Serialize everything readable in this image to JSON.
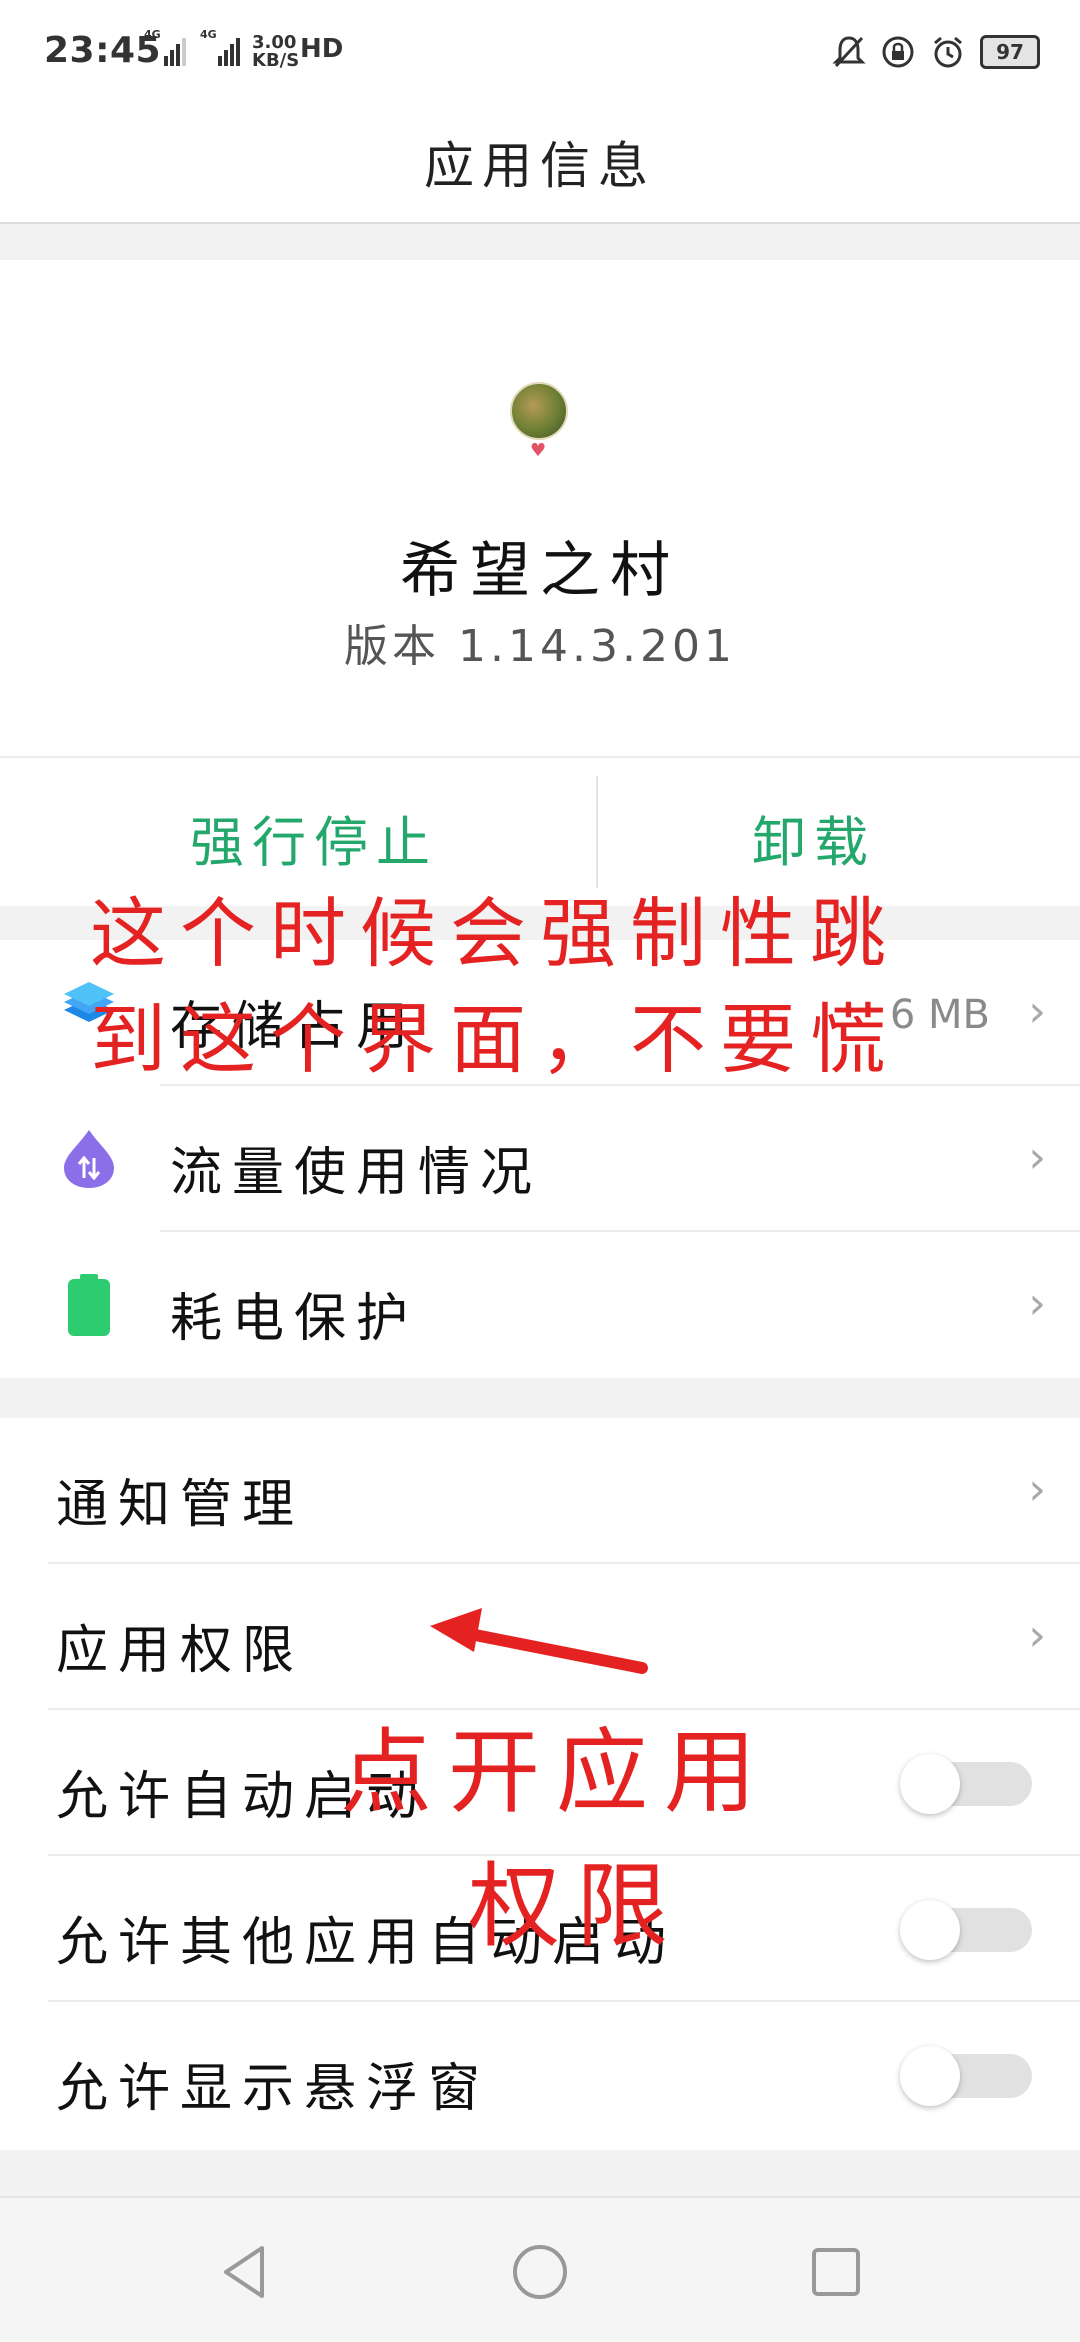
{
  "status_bar": {
    "time": "23:45",
    "network_speed_value": "3.00",
    "network_speed_unit": "KB/S",
    "hd_label": "HD",
    "battery": "97"
  },
  "header": {
    "title": "应用信息"
  },
  "app": {
    "name": "希望之村",
    "version": "版本 1.14.3.201"
  },
  "actions": {
    "force_stop": "强行停止",
    "uninstall": "卸载"
  },
  "sections": {
    "usage": [
      {
        "label": "存储占用",
        "value": "6 MB",
        "icon": "layers-icon"
      },
      {
        "label": "流量使用情况",
        "icon": "data-usage-icon"
      },
      {
        "label": "耗电保护",
        "icon": "battery-icon"
      }
    ],
    "settings": [
      {
        "label": "通知管理"
      },
      {
        "label": "应用权限"
      },
      {
        "label": "允许自动启动",
        "toggle": false
      },
      {
        "label": "允许其他应用自动启动",
        "toggle": false
      },
      {
        "label": "允许显示悬浮窗",
        "toggle": false
      }
    ]
  },
  "annotations": {
    "line1": "这个时候会强制性跳",
    "line2": "到这个界面，不要慌",
    "tap_line1": "点开应用",
    "tap_line2": "权限"
  },
  "colors": {
    "accent_green": "#23a76b",
    "annotation_red": "#e52222"
  }
}
